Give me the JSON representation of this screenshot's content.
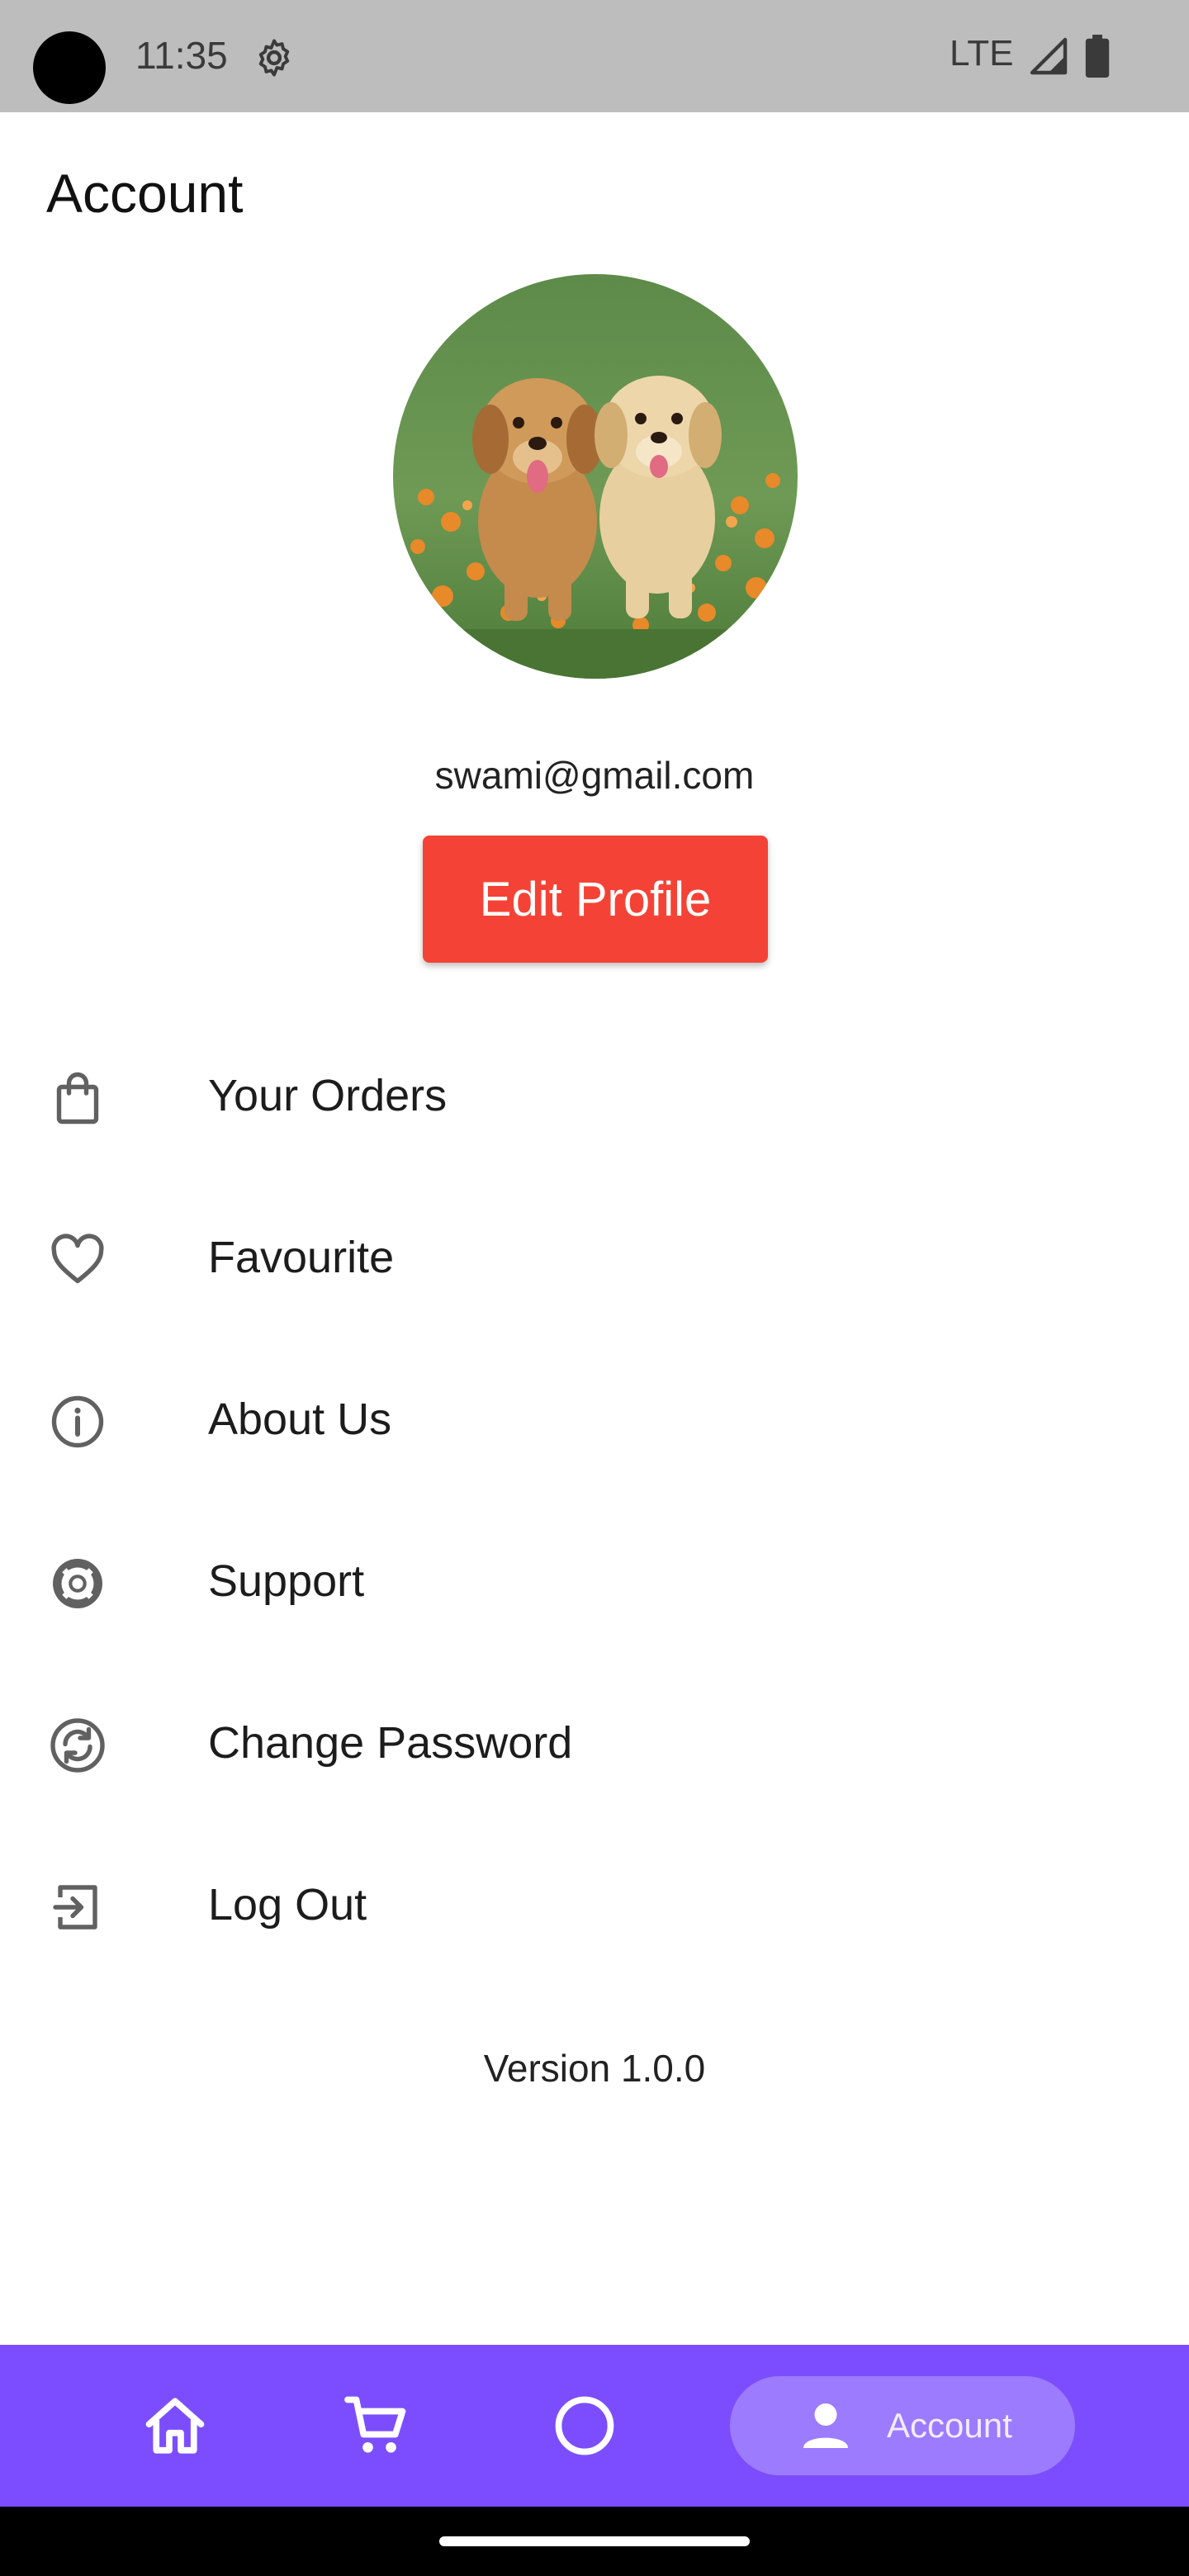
{
  "status_bar": {
    "time": "11:35",
    "network": "LTE",
    "icons": [
      "settings-gear-icon",
      "signal-icon",
      "battery-icon"
    ]
  },
  "header": {
    "title": "Account"
  },
  "profile": {
    "avatar_description_icon": "avatar-photo",
    "email": "swami@gmail.com",
    "edit_label": "Edit Profile",
    "edit_color": "#f44336"
  },
  "menu": {
    "items": [
      {
        "label": "Your Orders",
        "icon": "shopping-bag-icon"
      },
      {
        "label": "Favourite",
        "icon": "heart-icon"
      },
      {
        "label": "About Us",
        "icon": "info-icon"
      },
      {
        "label": "Support",
        "icon": "lifebuoy-icon"
      },
      {
        "label": "Change Password",
        "icon": "refresh-lock-icon"
      },
      {
        "label": "Log Out",
        "icon": "logout-icon"
      }
    ]
  },
  "footer": {
    "version": "Version 1.0.0"
  },
  "bottom_nav": {
    "accent": "#7c4dff",
    "items": [
      {
        "icon": "home-icon"
      },
      {
        "icon": "cart-icon"
      },
      {
        "icon": "circle-icon"
      },
      {
        "icon": "person-icon",
        "label": "Account",
        "active": true
      }
    ]
  }
}
